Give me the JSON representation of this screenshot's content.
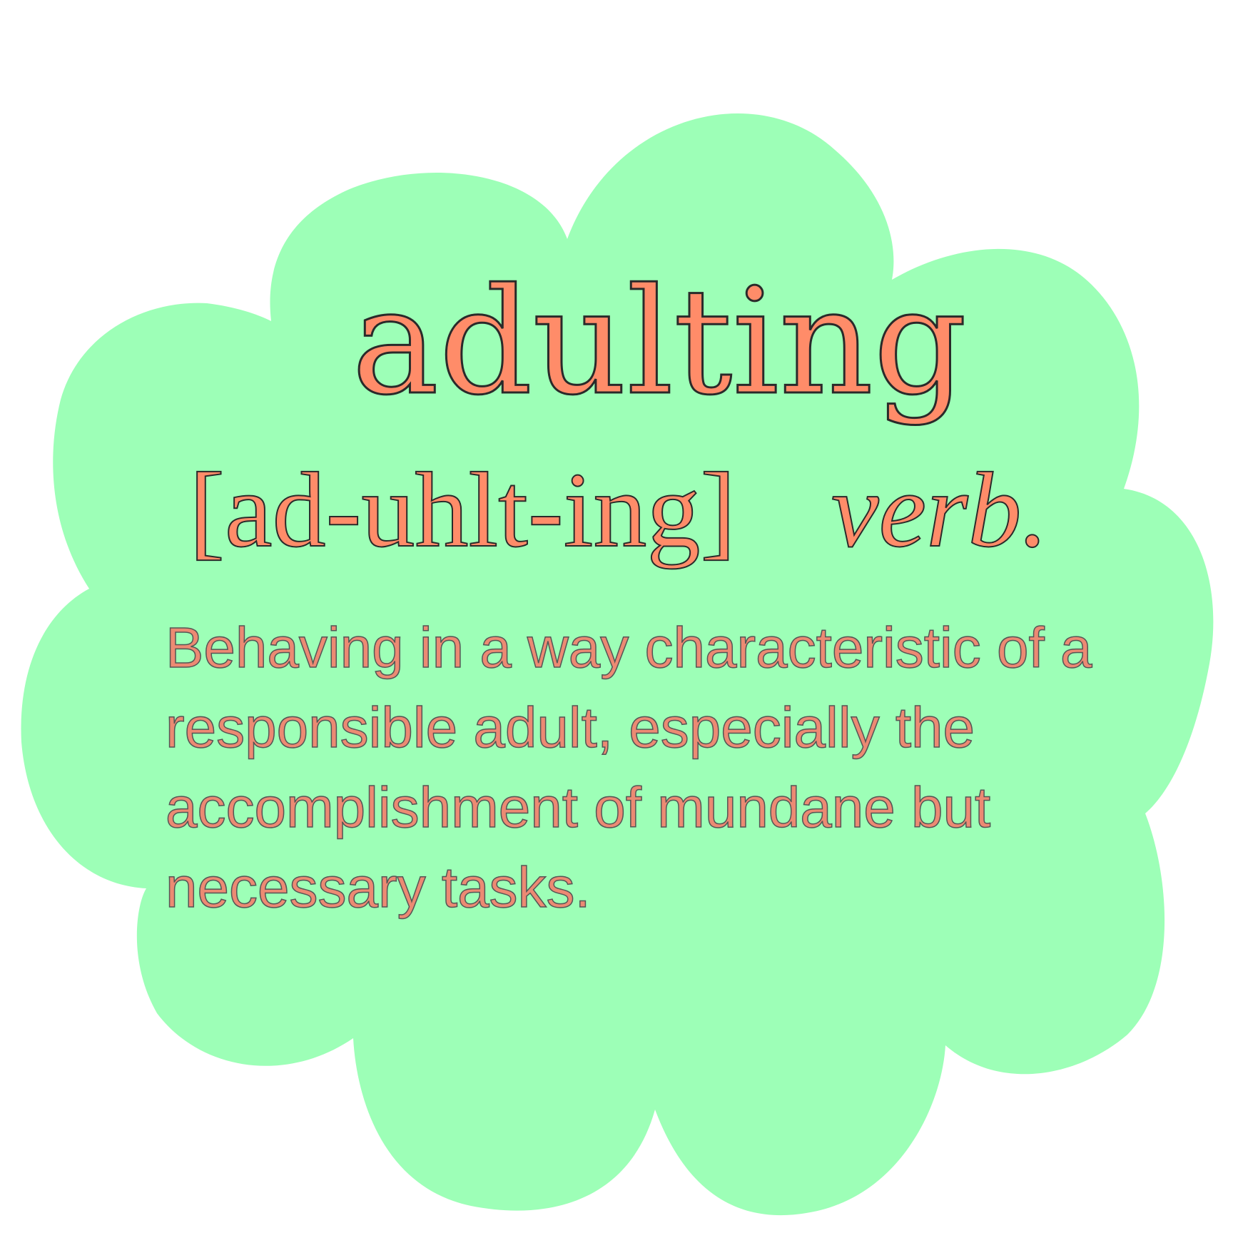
{
  "colors": {
    "cloud_fill": "#9dffb7",
    "text_fill": "#ff8c69",
    "text_outline": "#2a2a2a",
    "background": "#ffffff"
  },
  "entry": {
    "word": "adulting",
    "pronunciation": "[ad-uhlt-ing]",
    "part_of_speech": "verb.",
    "definition": "Behaving in a way characteristic of a responsible adult, especially the accomplishment of mundane but necessary tasks."
  }
}
